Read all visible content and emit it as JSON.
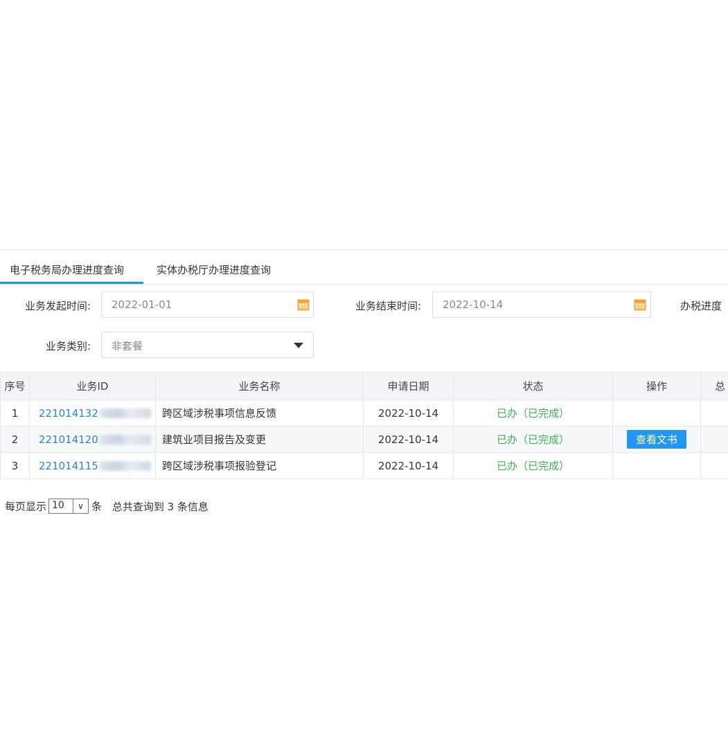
{
  "tabs": [
    {
      "label": "电子税务局办理进度查询",
      "active": true
    },
    {
      "label": "实体办税厅办理进度查询",
      "active": false
    }
  ],
  "filters": {
    "start_label": "业务发起时间:",
    "start_value": "2022-01-01",
    "end_label": "业务结束时间:",
    "end_value": "2022-10-14",
    "progress_label": "办税进度",
    "type_label": "业务类别:",
    "type_value": "非套餐"
  },
  "table": {
    "headers": [
      "序号",
      "业务ID",
      "业务名称",
      "申请日期",
      "状态",
      "操作",
      "总"
    ],
    "rows": [
      {
        "index": "1",
        "id": "221014132",
        "name": "跨区域涉税事项信息反馈",
        "date": "2022-10-14",
        "status": "已办（已完成）",
        "action": ""
      },
      {
        "index": "2",
        "id": "221014120",
        "name": "建筑业项目报告及变更",
        "date": "2022-10-14",
        "status": "已办（已完成）",
        "action": "查看文书"
      },
      {
        "index": "3",
        "id": "221014115",
        "name": "跨区域涉税事项报验登记",
        "date": "2022-10-14",
        "status": "已办（已完成）",
        "action": ""
      }
    ]
  },
  "pager": {
    "per_page_prefix": "每页显示",
    "per_page_value": "10",
    "per_page_suffix": "条",
    "total_text": "总共查询到 3 条信息"
  },
  "colors": {
    "accent": "#2196d9",
    "link": "#2a86c8",
    "status_done": "#3fae53",
    "button": "#2196f3"
  },
  "icons": {
    "date_picker": "calendar-icon",
    "dropdown": "caret-down-icon",
    "select": "chevron-down-icon"
  }
}
